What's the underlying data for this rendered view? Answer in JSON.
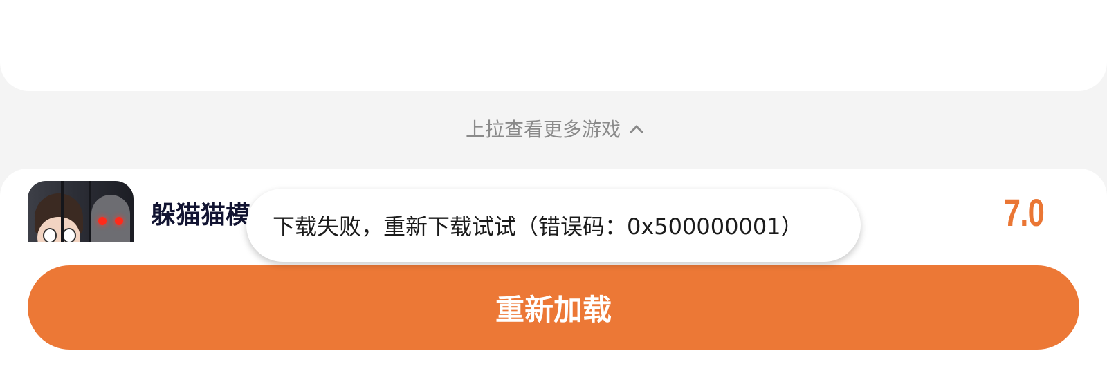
{
  "pull_hint": {
    "text": "上拉查看更多游戏",
    "icon": "chevron-up-icon"
  },
  "game": {
    "title": "躲猫猫模",
    "score": "7.0",
    "icon": "game-cover-image",
    "score_color": "#ea7634"
  },
  "toast": {
    "message": "下载失败，重新下载试试（错误码：0x500000001）"
  },
  "footer": {
    "reload_label": "重新加载",
    "button_color": "#ec7836"
  }
}
